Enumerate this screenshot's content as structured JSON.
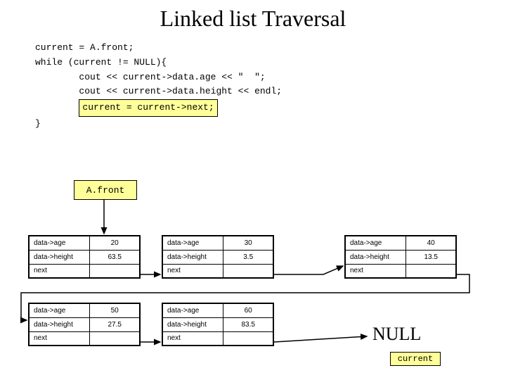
{
  "title": "Linked list Traversal",
  "code": {
    "l1": "current = A.front;",
    "l2": "while (current != NULL){",
    "l3": "cout << current->data.age << \"  \";",
    "l4": "cout << current->data.height << endl;",
    "l5": "current = current->next;",
    "l6": "}"
  },
  "front_label": "A.front",
  "field_labels": {
    "age": "data->age",
    "height": "data->height",
    "next": "next"
  },
  "nodes": [
    {
      "age": "20",
      "height": "63.5"
    },
    {
      "age": "30",
      "height": "3.5"
    },
    {
      "age": "40",
      "height": "13.5"
    },
    {
      "age": "50",
      "height": "27.5"
    },
    {
      "age": "60",
      "height": "83.5"
    }
  ],
  "null_label": "NULL",
  "current_label": "current"
}
